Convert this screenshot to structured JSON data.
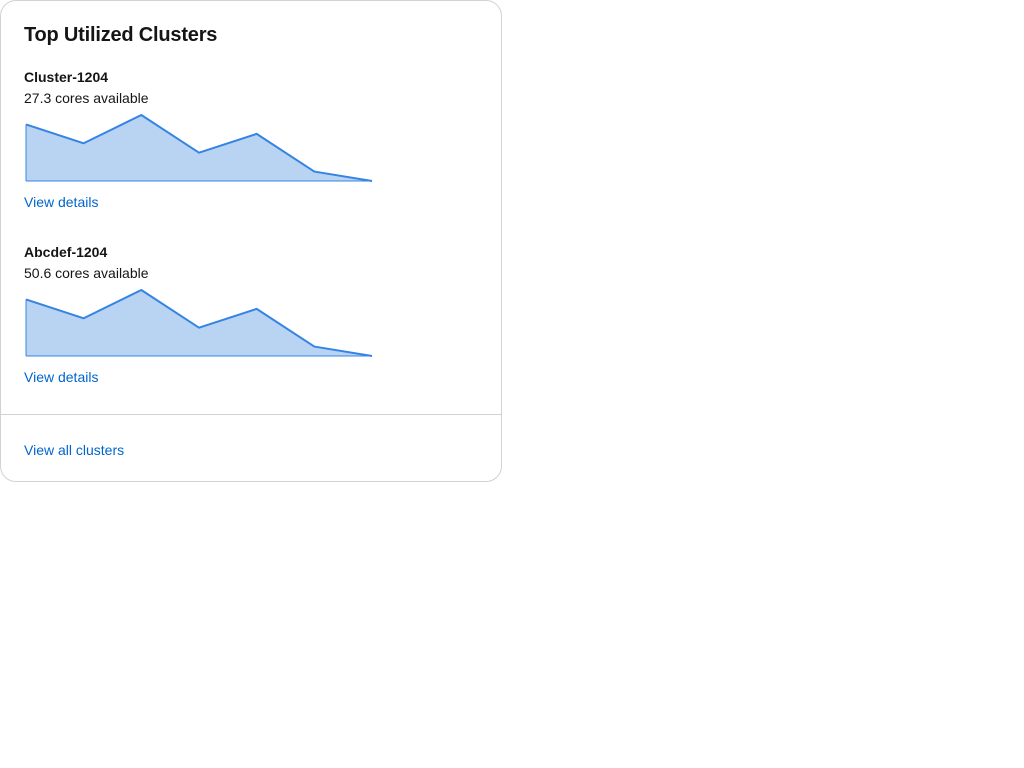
{
  "card": {
    "title": "Top Utilized Clusters",
    "footer_link": "View all clusters"
  },
  "colors": {
    "accent_link": "#0066cc",
    "spark_line": "#3584e4",
    "spark_fill": "#b9d3f3",
    "border": "#d2d2d2"
  },
  "clusters": [
    {
      "name": "Cluster-1204",
      "cores": "27.3 cores available",
      "link": "View details",
      "trend": [
        6,
        4,
        7,
        3,
        5,
        1,
        0
      ]
    },
    {
      "name": "Abcdef-1204",
      "cores": "50.6 cores available",
      "link": "View details",
      "trend": [
        6,
        4,
        7,
        3,
        5,
        1,
        0
      ]
    }
  ]
}
